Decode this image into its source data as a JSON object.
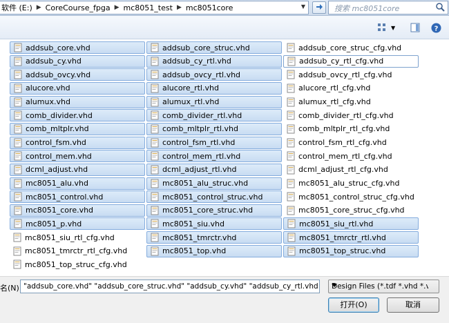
{
  "address_bar": {
    "crumbs": [
      "软件 (E:)",
      "CoreCourse_fpga",
      "mc8051_test",
      "mc8051core"
    ]
  },
  "search": {
    "placeholder": "搜索 mc8051core"
  },
  "toolbar": {
    "view_icon": "views-icon",
    "preview_icon": "preview-pane-icon",
    "help_icon": "help-icon"
  },
  "files": {
    "col1": [
      {
        "name": "addsub_core.vhd",
        "selected": true
      },
      {
        "name": "addsub_cy.vhd",
        "selected": true
      },
      {
        "name": "addsub_ovcy.vhd",
        "selected": true
      },
      {
        "name": "alucore.vhd",
        "selected": true
      },
      {
        "name": "alumux.vhd",
        "selected": true
      },
      {
        "name": "comb_divider.vhd",
        "selected": true
      },
      {
        "name": "comb_mltplr.vhd",
        "selected": true
      },
      {
        "name": "control_fsm.vhd",
        "selected": true
      },
      {
        "name": "control_mem.vhd",
        "selected": true
      },
      {
        "name": "dcml_adjust.vhd",
        "selected": true
      },
      {
        "name": "mc8051_alu.vhd",
        "selected": true
      },
      {
        "name": "mc8051_control.vhd",
        "selected": true
      },
      {
        "name": "mc8051_core.vhd",
        "selected": true
      },
      {
        "name": "mc8051_p.vhd",
        "selected": true
      },
      {
        "name": "mc8051_siu_rtl_cfg.vhd",
        "selected": false
      },
      {
        "name": "mc8051_tmrctr_rtl_cfg.vhd",
        "selected": false
      },
      {
        "name": "mc8051_top_struc_cfg.vhd",
        "selected": false
      }
    ],
    "col2": [
      {
        "name": "addsub_core_struc.vhd",
        "selected": true
      },
      {
        "name": "addsub_cy_rtl.vhd",
        "selected": true
      },
      {
        "name": "addsub_ovcy_rtl.vhd",
        "selected": true
      },
      {
        "name": "alucore_rtl.vhd",
        "selected": true
      },
      {
        "name": "alumux_rtl.vhd",
        "selected": true
      },
      {
        "name": "comb_divider_rtl.vhd",
        "selected": true
      },
      {
        "name": "comb_mltplr_rtl.vhd",
        "selected": true
      },
      {
        "name": "control_fsm_rtl.vhd",
        "selected": true
      },
      {
        "name": "control_mem_rtl.vhd",
        "selected": true
      },
      {
        "name": "dcml_adjust_rtl.vhd",
        "selected": true
      },
      {
        "name": "mc8051_alu_struc.vhd",
        "selected": true
      },
      {
        "name": "mc8051_control_struc.vhd",
        "selected": true
      },
      {
        "name": "mc8051_core_struc.vhd",
        "selected": true
      },
      {
        "name": "mc8051_siu.vhd",
        "selected": true
      },
      {
        "name": "mc8051_tmrctr.vhd",
        "selected": true
      },
      {
        "name": "mc8051_top.vhd",
        "selected": true
      }
    ],
    "col3": [
      {
        "name": "addsub_core_struc_cfg.vhd",
        "selected": false
      },
      {
        "name": "addsub_cy_rtl_cfg.vhd",
        "selected": false,
        "focused": true
      },
      {
        "name": "addsub_ovcy_rtl_cfg.vhd",
        "selected": false
      },
      {
        "name": "alucore_rtl_cfg.vhd",
        "selected": false
      },
      {
        "name": "alumux_rtl_cfg.vhd",
        "selected": false
      },
      {
        "name": "comb_divider_rtl_cfg.vhd",
        "selected": false
      },
      {
        "name": "comb_mltplr_rtl_cfg.vhd",
        "selected": false
      },
      {
        "name": "control_fsm_rtl_cfg.vhd",
        "selected": false
      },
      {
        "name": "control_mem_rtl_cfg.vhd",
        "selected": false
      },
      {
        "name": "dcml_adjust_rtl_cfg.vhd",
        "selected": false
      },
      {
        "name": "mc8051_alu_struc_cfg.vhd",
        "selected": false
      },
      {
        "name": "mc8051_control_struc_cfg.vhd",
        "selected": false
      },
      {
        "name": "mc8051_core_struc_cfg.vhd",
        "selected": false
      },
      {
        "name": "mc8051_siu_rtl.vhd",
        "selected": true
      },
      {
        "name": "mc8051_tmrctr_rtl.vhd",
        "selected": true
      },
      {
        "name": "mc8051_top_struc.vhd",
        "selected": true
      }
    ]
  },
  "bottom": {
    "filename_label": "名(N):",
    "filename_value": "\"addsub_core.vhd\" \"addsub_core_struc.vhd\" \"addsub_cy.vhd\" \"addsub_cy_rtl.vhd\" \"a",
    "filter_value": "Design Files (*.tdf *.vhd *.vhc",
    "open_label": "打开(O)",
    "cancel_label": "取消"
  },
  "colors": {
    "selection_bg": "#c8dcf2",
    "selection_border": "#84acdd",
    "chrome": "#dfe9f5"
  }
}
